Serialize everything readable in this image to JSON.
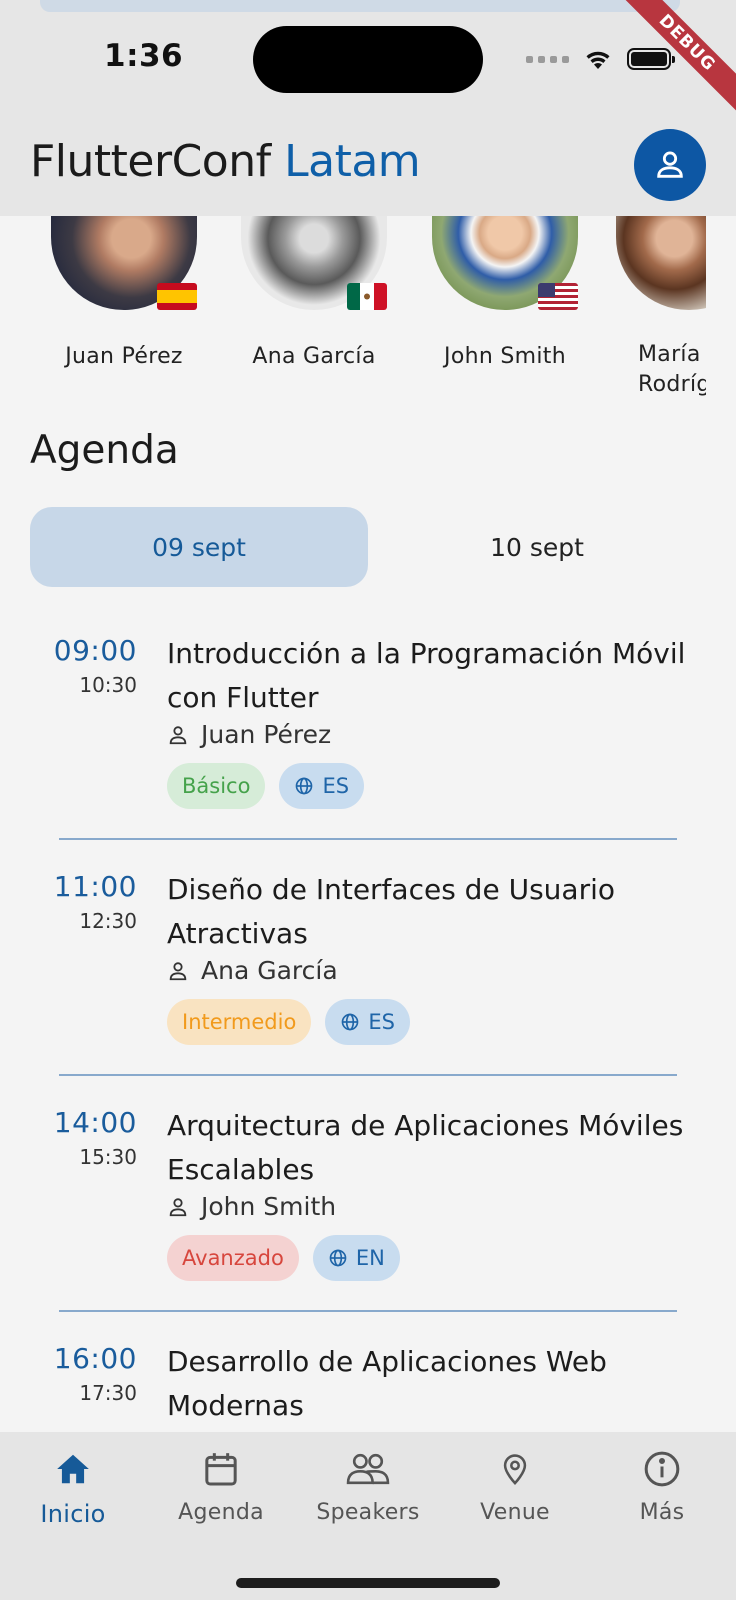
{
  "status_bar": {
    "time": "1:36",
    "debug_label": "DEBUG"
  },
  "app_bar": {
    "title_main": "FlutterConf",
    "title_accent": "Latam",
    "profile_icon": "person-icon",
    "accent_color": "#0d57a4"
  },
  "speakers": [
    {
      "name": "Juan Pérez",
      "flag": "spain-flag-icon"
    },
    {
      "name": "Ana García",
      "flag": "mexico-flag-icon"
    },
    {
      "name": "John Smith",
      "flag": "usa-flag-icon"
    },
    {
      "name": "María Rodríguez",
      "flag": ""
    }
  ],
  "agenda": {
    "title": "Agenda",
    "days": [
      {
        "label": "09 sept",
        "selected": true
      },
      {
        "label": "10 sept",
        "selected": false
      }
    ],
    "sessions": [
      {
        "start": "09:00",
        "end": "10:30",
        "title": "Introducción a la Programación Móvil con Flutter",
        "speaker": "Juan Pérez",
        "level": "Básico",
        "level_key": "basico",
        "language": "ES"
      },
      {
        "start": "11:00",
        "end": "12:30",
        "title": "Diseño de Interfaces de Usuario Atractivas",
        "speaker": "Ana García",
        "level": "Intermedio",
        "level_key": "intermedio",
        "language": "ES"
      },
      {
        "start": "14:00",
        "end": "15:30",
        "title": "Arquitectura de Aplicaciones Móviles Escalables",
        "speaker": "John Smith",
        "level": "Avanzado",
        "level_key": "avanzado",
        "language": "EN"
      },
      {
        "start": "16:00",
        "end": "17:30",
        "title": "Desarrollo de Aplicaciones Web Modernas",
        "speaker": "",
        "level": "",
        "level_key": "",
        "language": ""
      }
    ]
  },
  "bottom_nav": [
    {
      "label": "Inicio",
      "icon": "home-icon",
      "active": true
    },
    {
      "label": "Agenda",
      "icon": "calendar-icon",
      "active": false
    },
    {
      "label": "Speakers",
      "icon": "people-icon",
      "active": false
    },
    {
      "label": "Venue",
      "icon": "location-pin-icon",
      "active": false
    },
    {
      "label": "Más",
      "icon": "info-icon",
      "active": false
    }
  ],
  "colors": {
    "primary": "#0d57a4",
    "time_blue": "#1a5c9c",
    "tab_selected_bg": "#c7d7e8",
    "basico": "#45a24b",
    "intermedio": "#f19a1c",
    "avanzado": "#d7463d",
    "divider": "#88a9cc"
  }
}
